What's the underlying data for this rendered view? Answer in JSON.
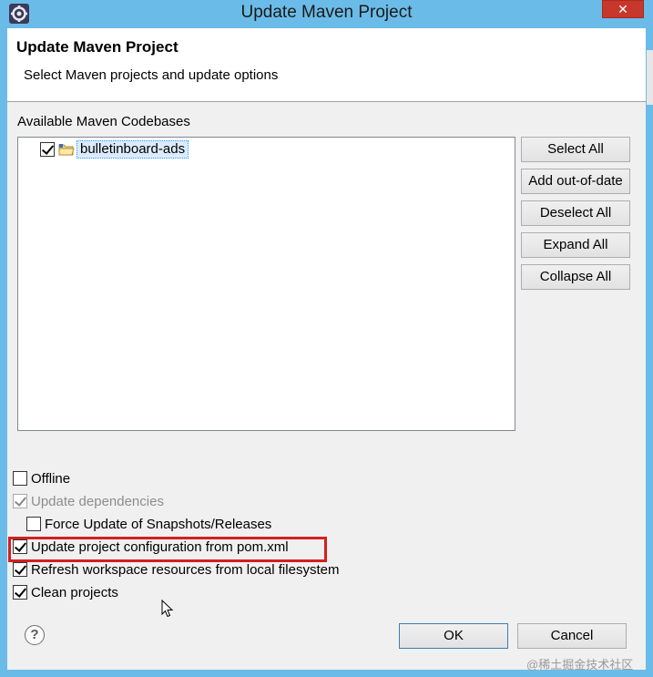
{
  "window": {
    "title": "Update Maven Project",
    "close_label": "✕"
  },
  "header": {
    "title": "Update Maven Project",
    "subtitle": "Select Maven projects and update options"
  },
  "codebases": {
    "label": "Available Maven Codebases",
    "items": [
      {
        "name": "bulletinboard-ads",
        "checked": true
      }
    ]
  },
  "side_buttons": {
    "select_all": "Select All",
    "add_out_of_date": "Add out-of-date",
    "deselect_all": "Deselect All",
    "expand_all": "Expand All",
    "collapse_all": "Collapse All"
  },
  "options": {
    "offline": {
      "label": "Offline",
      "checked": false,
      "enabled": true
    },
    "update_dependencies": {
      "label": "Update dependencies",
      "checked": true,
      "enabled": false
    },
    "force_update": {
      "label": "Force Update of Snapshots/Releases",
      "checked": false,
      "enabled": true
    },
    "update_config": {
      "label": "Update project configuration from pom.xml",
      "checked": true,
      "enabled": true
    },
    "refresh_workspace": {
      "label": "Refresh workspace resources from local filesystem",
      "checked": true,
      "enabled": true
    },
    "clean_projects": {
      "label": "Clean projects",
      "checked": true,
      "enabled": true
    }
  },
  "footer": {
    "help_label": "?",
    "ok_label": "OK",
    "cancel_label": "Cancel"
  },
  "watermark": "@稀土掘金技术社区",
  "colors": {
    "titlebar": "#6bbbe8",
    "close": "#c8372c",
    "highlight": "#d41f1f",
    "selection": "#dcebfc"
  }
}
